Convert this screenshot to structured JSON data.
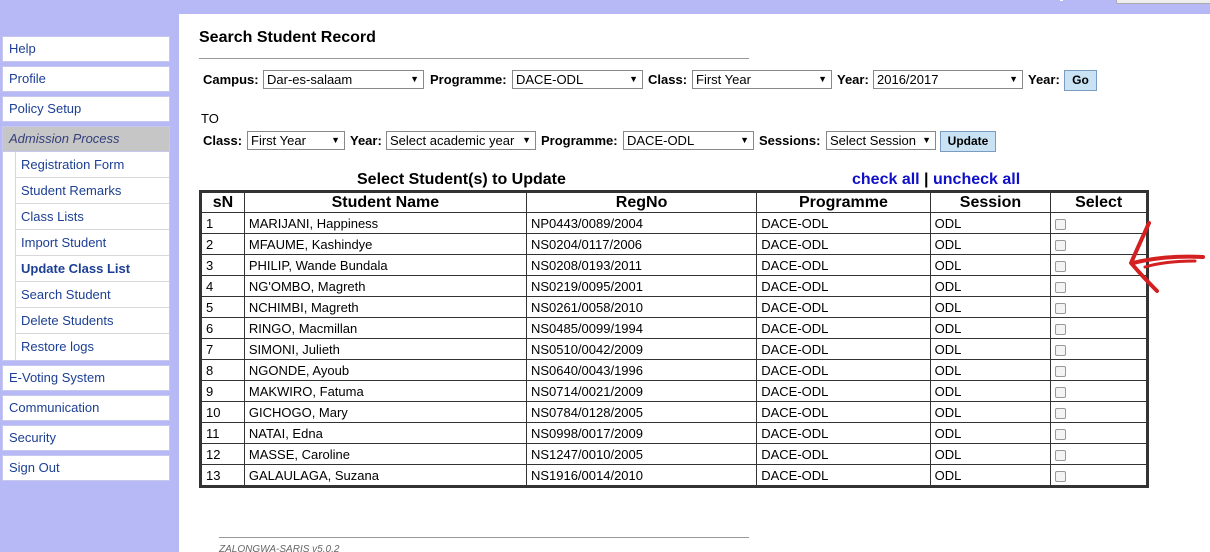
{
  "sidebar": {
    "items": [
      {
        "label": "Help"
      },
      {
        "label": "Profile"
      },
      {
        "label": "Policy Setup"
      }
    ],
    "active": {
      "label": "Admission Process"
    },
    "subitems": [
      {
        "label": "Registration Form"
      },
      {
        "label": "Student Remarks"
      },
      {
        "label": "Class Lists"
      },
      {
        "label": "Import Student"
      },
      {
        "label": "Update Class List"
      },
      {
        "label": "Search Student"
      },
      {
        "label": "Delete Students"
      },
      {
        "label": "Restore logs"
      }
    ],
    "bottom_items": [
      {
        "label": "E-Voting System"
      },
      {
        "label": "Communication"
      },
      {
        "label": "Security"
      },
      {
        "label": "Sign Out"
      }
    ]
  },
  "page": {
    "title": "Search Student Record",
    "to_label": "TO"
  },
  "filter1": {
    "campus_label": "Campus:",
    "campus_value": "Dar-es-salaam",
    "programme_label": "Programme:",
    "programme_value": "DACE-ODL",
    "class_label": "Class:",
    "class_value": "First Year",
    "year_label": "Year:",
    "year_value": "2016/2017",
    "year2_label": "Year:",
    "go_label": "Go"
  },
  "filter2": {
    "class_label": "Class:",
    "class_value": "First Year",
    "year_label": "Year:",
    "year_value": "Select academic year",
    "programme_label": "Programme:",
    "programme_value": "DACE-ODL",
    "sessions_label": "Sessions:",
    "sessions_value": "Select Session",
    "update_label": "Update"
  },
  "table": {
    "title": "Select Student(s) to Update",
    "check_all": "check all",
    "separator": "|",
    "uncheck_all": "uncheck all",
    "headers": [
      "sN",
      "Student Name",
      "RegNo",
      "Programme",
      "Session",
      "Select"
    ],
    "rows": [
      {
        "sn": "1",
        "name": "MARIJANI, Happiness",
        "regno": "NP0443/0089/2004",
        "programme": "DACE-ODL",
        "session": "ODL"
      },
      {
        "sn": "2",
        "name": "MFAUME, Kashindye",
        "regno": "NS0204/0117/2006",
        "programme": "DACE-ODL",
        "session": "ODL"
      },
      {
        "sn": "3",
        "name": "PHILIP, Wande Bundala",
        "regno": "NS0208/0193/2011",
        "programme": "DACE-ODL",
        "session": "ODL"
      },
      {
        "sn": "4",
        "name": "NG'OMBO, Magreth",
        "regno": "NS0219/0095/2001",
        "programme": "DACE-ODL",
        "session": "ODL"
      },
      {
        "sn": "5",
        "name": "NCHIMBI, Magreth",
        "regno": "NS0261/0058/2010",
        "programme": "DACE-ODL",
        "session": "ODL"
      },
      {
        "sn": "6",
        "name": "RINGO, Macmillan",
        "regno": "NS0485/0099/1994",
        "programme": "DACE-ODL",
        "session": "ODL"
      },
      {
        "sn": "7",
        "name": "SIMONI, Julieth",
        "regno": "NS0510/0042/2009",
        "programme": "DACE-ODL",
        "session": "ODL"
      },
      {
        "sn": "8",
        "name": "NGONDE, Ayoub",
        "regno": "NS0640/0043/1996",
        "programme": "DACE-ODL",
        "session": "ODL"
      },
      {
        "sn": "9",
        "name": "MAKWIRO, Fatuma",
        "regno": "NS0714/0021/2009",
        "programme": "DACE-ODL",
        "session": "ODL"
      },
      {
        "sn": "10",
        "name": "GICHOGO, Mary",
        "regno": "NS0784/0128/2005",
        "programme": "DACE-ODL",
        "session": "ODL"
      },
      {
        "sn": "11",
        "name": "NATAI, Edna",
        "regno": "NS0998/0017/2009",
        "programme": "DACE-ODL",
        "session": "ODL"
      },
      {
        "sn": "12",
        "name": "MASSE, Caroline",
        "regno": "NS1247/0010/2005",
        "programme": "DACE-ODL",
        "session": "ODL"
      },
      {
        "sn": "13",
        "name": "GALAULAGA, Suzana",
        "regno": "NS1916/0014/2010",
        "programme": "DACE-ODL",
        "session": "ODL"
      }
    ]
  },
  "footer": {
    "text": "ZALONGWA-SARIS v5.0.2"
  },
  "colors": {
    "background": "#b7b9f7",
    "link": "#1010c8",
    "nav_text": "#1c3f94",
    "annotation_arrow": "#d42020"
  }
}
